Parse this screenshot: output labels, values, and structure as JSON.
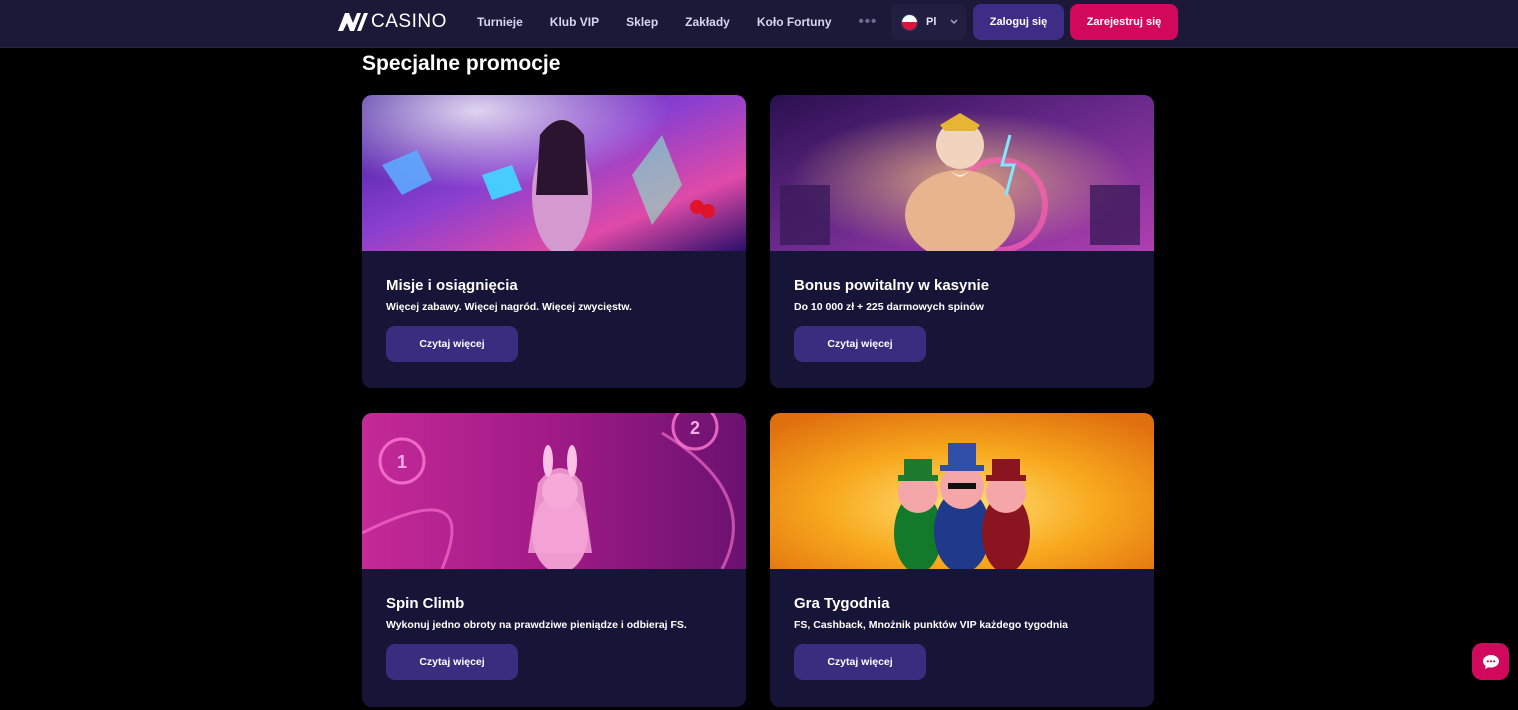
{
  "brand": {
    "logo_text": "CASINO",
    "logo_mark": "N"
  },
  "nav": {
    "items": [
      {
        "label": "Turnieje"
      },
      {
        "label": "Klub VIP"
      },
      {
        "label": "Sklep"
      },
      {
        "label": "Zakłady"
      },
      {
        "label": "Koło Fortuny"
      }
    ],
    "more_label": "•••"
  },
  "language": {
    "label": "Pl",
    "icon": "poland-flag-icon"
  },
  "auth": {
    "login_label": "Zaloguj się",
    "register_label": "Zarejestruj się"
  },
  "section": {
    "title": "Specjalne promocje"
  },
  "promotions": [
    {
      "title": "Misje i osiągnięcia",
      "subtitle": "Więcej zabawy. Więcej nagród. Więcej zwycięstw.",
      "button": "Czytaj więcej",
      "image": "casino-woman-diamond-artwork"
    },
    {
      "title": "Bonus powitalny w kasynie",
      "subtitle": "Do 10 000 zł + 225 darmowych spinów",
      "button": "Czytaj więcej",
      "image": "zeus-lightning-artwork"
    },
    {
      "title": "Spin Climb",
      "subtitle": "Wykonuj jedno obroty na prawdziwe pieniądze i odbieraj FS.",
      "button": "Czytaj więcej",
      "image": "bunny-girl-artwork"
    },
    {
      "title": "Gra Tygodnia",
      "subtitle": "FS, Cashback, Mnożnik punktów VIP każdego tygodnia",
      "button": "Czytaj więcej",
      "image": "three-pigs-artwork"
    }
  ],
  "chat": {
    "icon": "chat-bubble-icon"
  },
  "colors": {
    "header_bg": "#1b1838",
    "card_bg": "#171537",
    "primary_button": "#3a2d80",
    "accent": "#d1085c"
  }
}
